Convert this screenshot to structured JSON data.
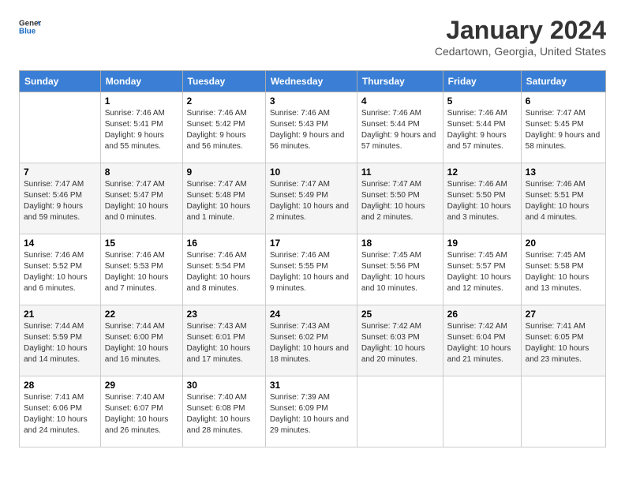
{
  "header": {
    "logo_general": "General",
    "logo_blue": "Blue",
    "title": "January 2024",
    "subtitle": "Cedartown, Georgia, United States"
  },
  "calendar": {
    "days_of_week": [
      "Sunday",
      "Monday",
      "Tuesday",
      "Wednesday",
      "Thursday",
      "Friday",
      "Saturday"
    ],
    "weeks": [
      [
        {
          "day": "",
          "sunrise": "",
          "sunset": "",
          "daylight": ""
        },
        {
          "day": "1",
          "sunrise": "Sunrise: 7:46 AM",
          "sunset": "Sunset: 5:41 PM",
          "daylight": "Daylight: 9 hours and 55 minutes."
        },
        {
          "day": "2",
          "sunrise": "Sunrise: 7:46 AM",
          "sunset": "Sunset: 5:42 PM",
          "daylight": "Daylight: 9 hours and 56 minutes."
        },
        {
          "day": "3",
          "sunrise": "Sunrise: 7:46 AM",
          "sunset": "Sunset: 5:43 PM",
          "daylight": "Daylight: 9 hours and 56 minutes."
        },
        {
          "day": "4",
          "sunrise": "Sunrise: 7:46 AM",
          "sunset": "Sunset: 5:44 PM",
          "daylight": "Daylight: 9 hours and 57 minutes."
        },
        {
          "day": "5",
          "sunrise": "Sunrise: 7:46 AM",
          "sunset": "Sunset: 5:44 PM",
          "daylight": "Daylight: 9 hours and 57 minutes."
        },
        {
          "day": "6",
          "sunrise": "Sunrise: 7:47 AM",
          "sunset": "Sunset: 5:45 PM",
          "daylight": "Daylight: 9 hours and 58 minutes."
        }
      ],
      [
        {
          "day": "7",
          "sunrise": "Sunrise: 7:47 AM",
          "sunset": "Sunset: 5:46 PM",
          "daylight": "Daylight: 9 hours and 59 minutes."
        },
        {
          "day": "8",
          "sunrise": "Sunrise: 7:47 AM",
          "sunset": "Sunset: 5:47 PM",
          "daylight": "Daylight: 10 hours and 0 minutes."
        },
        {
          "day": "9",
          "sunrise": "Sunrise: 7:47 AM",
          "sunset": "Sunset: 5:48 PM",
          "daylight": "Daylight: 10 hours and 1 minute."
        },
        {
          "day": "10",
          "sunrise": "Sunrise: 7:47 AM",
          "sunset": "Sunset: 5:49 PM",
          "daylight": "Daylight: 10 hours and 2 minutes."
        },
        {
          "day": "11",
          "sunrise": "Sunrise: 7:47 AM",
          "sunset": "Sunset: 5:50 PM",
          "daylight": "Daylight: 10 hours and 2 minutes."
        },
        {
          "day": "12",
          "sunrise": "Sunrise: 7:46 AM",
          "sunset": "Sunset: 5:50 PM",
          "daylight": "Daylight: 10 hours and 3 minutes."
        },
        {
          "day": "13",
          "sunrise": "Sunrise: 7:46 AM",
          "sunset": "Sunset: 5:51 PM",
          "daylight": "Daylight: 10 hours and 4 minutes."
        }
      ],
      [
        {
          "day": "14",
          "sunrise": "Sunrise: 7:46 AM",
          "sunset": "Sunset: 5:52 PM",
          "daylight": "Daylight: 10 hours and 6 minutes."
        },
        {
          "day": "15",
          "sunrise": "Sunrise: 7:46 AM",
          "sunset": "Sunset: 5:53 PM",
          "daylight": "Daylight: 10 hours and 7 minutes."
        },
        {
          "day": "16",
          "sunrise": "Sunrise: 7:46 AM",
          "sunset": "Sunset: 5:54 PM",
          "daylight": "Daylight: 10 hours and 8 minutes."
        },
        {
          "day": "17",
          "sunrise": "Sunrise: 7:46 AM",
          "sunset": "Sunset: 5:55 PM",
          "daylight": "Daylight: 10 hours and 9 minutes."
        },
        {
          "day": "18",
          "sunrise": "Sunrise: 7:45 AM",
          "sunset": "Sunset: 5:56 PM",
          "daylight": "Daylight: 10 hours and 10 minutes."
        },
        {
          "day": "19",
          "sunrise": "Sunrise: 7:45 AM",
          "sunset": "Sunset: 5:57 PM",
          "daylight": "Daylight: 10 hours and 12 minutes."
        },
        {
          "day": "20",
          "sunrise": "Sunrise: 7:45 AM",
          "sunset": "Sunset: 5:58 PM",
          "daylight": "Daylight: 10 hours and 13 minutes."
        }
      ],
      [
        {
          "day": "21",
          "sunrise": "Sunrise: 7:44 AM",
          "sunset": "Sunset: 5:59 PM",
          "daylight": "Daylight: 10 hours and 14 minutes."
        },
        {
          "day": "22",
          "sunrise": "Sunrise: 7:44 AM",
          "sunset": "Sunset: 6:00 PM",
          "daylight": "Daylight: 10 hours and 16 minutes."
        },
        {
          "day": "23",
          "sunrise": "Sunrise: 7:43 AM",
          "sunset": "Sunset: 6:01 PM",
          "daylight": "Daylight: 10 hours and 17 minutes."
        },
        {
          "day": "24",
          "sunrise": "Sunrise: 7:43 AM",
          "sunset": "Sunset: 6:02 PM",
          "daylight": "Daylight: 10 hours and 18 minutes."
        },
        {
          "day": "25",
          "sunrise": "Sunrise: 7:42 AM",
          "sunset": "Sunset: 6:03 PM",
          "daylight": "Daylight: 10 hours and 20 minutes."
        },
        {
          "day": "26",
          "sunrise": "Sunrise: 7:42 AM",
          "sunset": "Sunset: 6:04 PM",
          "daylight": "Daylight: 10 hours and 21 minutes."
        },
        {
          "day": "27",
          "sunrise": "Sunrise: 7:41 AM",
          "sunset": "Sunset: 6:05 PM",
          "daylight": "Daylight: 10 hours and 23 minutes."
        }
      ],
      [
        {
          "day": "28",
          "sunrise": "Sunrise: 7:41 AM",
          "sunset": "Sunset: 6:06 PM",
          "daylight": "Daylight: 10 hours and 24 minutes."
        },
        {
          "day": "29",
          "sunrise": "Sunrise: 7:40 AM",
          "sunset": "Sunset: 6:07 PM",
          "daylight": "Daylight: 10 hours and 26 minutes."
        },
        {
          "day": "30",
          "sunrise": "Sunrise: 7:40 AM",
          "sunset": "Sunset: 6:08 PM",
          "daylight": "Daylight: 10 hours and 28 minutes."
        },
        {
          "day": "31",
          "sunrise": "Sunrise: 7:39 AM",
          "sunset": "Sunset: 6:09 PM",
          "daylight": "Daylight: 10 hours and 29 minutes."
        },
        {
          "day": "",
          "sunrise": "",
          "sunset": "",
          "daylight": ""
        },
        {
          "day": "",
          "sunrise": "",
          "sunset": "",
          "daylight": ""
        },
        {
          "day": "",
          "sunrise": "",
          "sunset": "",
          "daylight": ""
        }
      ]
    ]
  }
}
